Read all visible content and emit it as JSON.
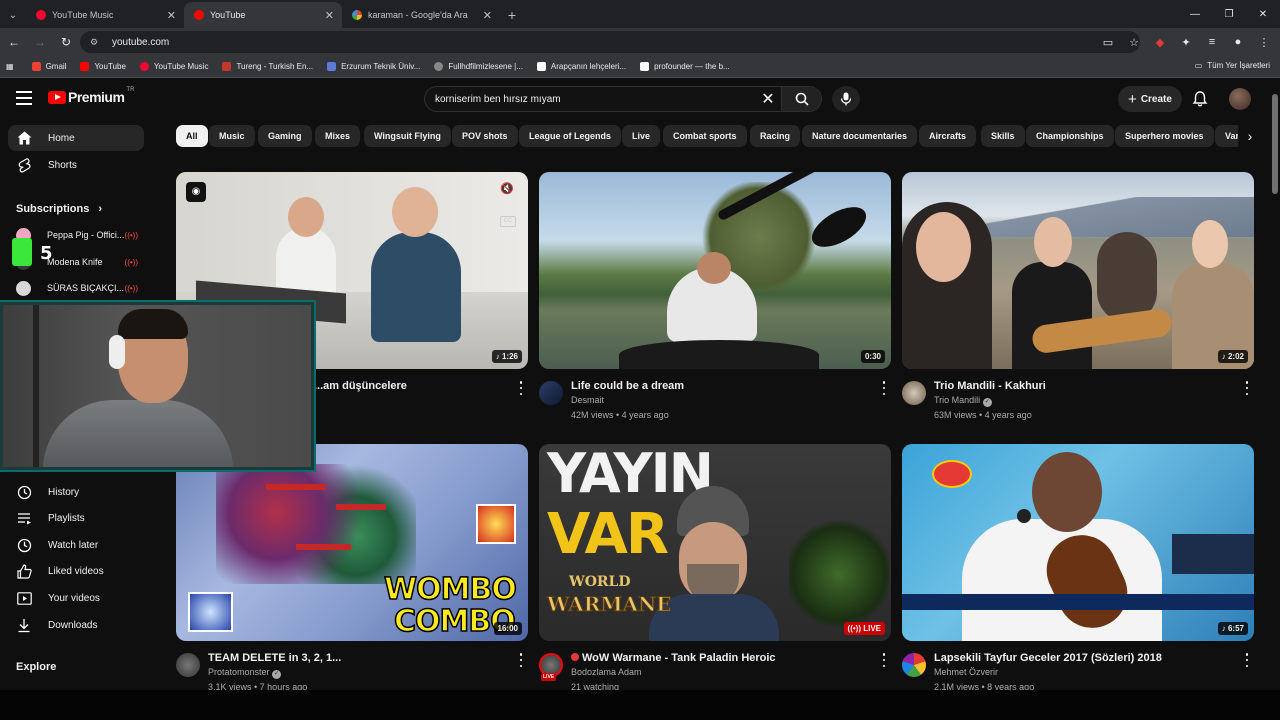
{
  "browser": {
    "tabs": [
      {
        "title": "YouTube Music",
        "color": "#ff0033"
      },
      {
        "title": "YouTube",
        "color": "#ff0000"
      },
      {
        "title": "karaman - Google'da Ara",
        "color": "#4285f4"
      }
    ],
    "url": "youtube.com",
    "bookmarks": [
      {
        "label": "Gmail",
        "color": "#ea4335"
      },
      {
        "label": "YouTube",
        "color": "#ff0000"
      },
      {
        "label": "YouTube Music",
        "color": "#ff0033"
      },
      {
        "label": "Tureng - Turkish En...",
        "color": "#c0392b"
      },
      {
        "label": "Erzurum Teknik Üniv...",
        "color": "#5b7bd5"
      },
      {
        "label": "Fullhdfilmizlesene |...",
        "color": "#333333"
      },
      {
        "label": "Arapçanın lehçeleri...",
        "color": "#ffffff"
      },
      {
        "label": "profounder — the b...",
        "color": "#ffffff"
      }
    ],
    "bookmarks_other": "Tüm Yer İşaretleri"
  },
  "youtube": {
    "logo_text": "Premium",
    "logo_country": "TR",
    "search_value": "korniserim ben hırsız mıyam",
    "create_label": "Create",
    "chips": [
      "All",
      "Music",
      "Gaming",
      "Mixes",
      "Wingsuit Flying",
      "POV shots",
      "League of Legends",
      "Live",
      "Combat sports",
      "Racing",
      "Nature documentaries",
      "Aircrafts",
      "Skills",
      "Championships",
      "Superhero movies",
      "Vari"
    ],
    "sidebar": {
      "home": "Home",
      "shorts": "Shorts",
      "subscriptions_heading": "Subscriptions",
      "subscriptions": [
        {
          "name": "Peppa Pig - Offici...",
          "color": "#f4a7c3"
        },
        {
          "name": "Modena Knife",
          "color": "#3a3a3a"
        },
        {
          "name": "SÜRAS BIÇAKÇI...",
          "color": "#d8d8d8"
        }
      ],
      "you_items": [
        "History",
        "Playlists",
        "Watch later",
        "Liked videos",
        "Your videos",
        "Downloads"
      ],
      "explore_heading": "Explore"
    },
    "videos": [
      {
        "title": "...am düşüncelere",
        "channel": "",
        "stats": "",
        "duration": "1:26"
      },
      {
        "title": "Life could be a dream",
        "channel": "Desmait",
        "stats": "42M views • 4 years ago",
        "duration": "0:30"
      },
      {
        "title": "Trio Mandili - Kakhuri",
        "channel": "Trio Mandili",
        "stats": "63M views • 4 years ago",
        "duration": "2:02"
      },
      {
        "title": "TEAM DELETE in 3, 2, 1...",
        "channel": "Protatomonster",
        "stats": "3.1K views • 7 hours ago",
        "duration": "16:00"
      },
      {
        "title": "WoW Warmane - Tank Paladin Heroic",
        "channel": "Bodozlama Adam",
        "stats": "21 watching",
        "duration": "LIVE"
      },
      {
        "title": "Lapsekili Tayfur Geceler 2017 (Sözleri) 2018",
        "channel": "Mehmet Özverir",
        "stats": "2.1M views • 8 years ago",
        "duration": "6:57"
      }
    ],
    "thumb_texts": {
      "wombo": "WOMBO",
      "combo": "COMBO",
      "yayin": "YAYIN",
      "var": "VAR",
      "world": "WORLD",
      "warmane": "WARMANE",
      "live_badge": "LIVE"
    }
  },
  "overlay": {
    "counter": "5"
  }
}
